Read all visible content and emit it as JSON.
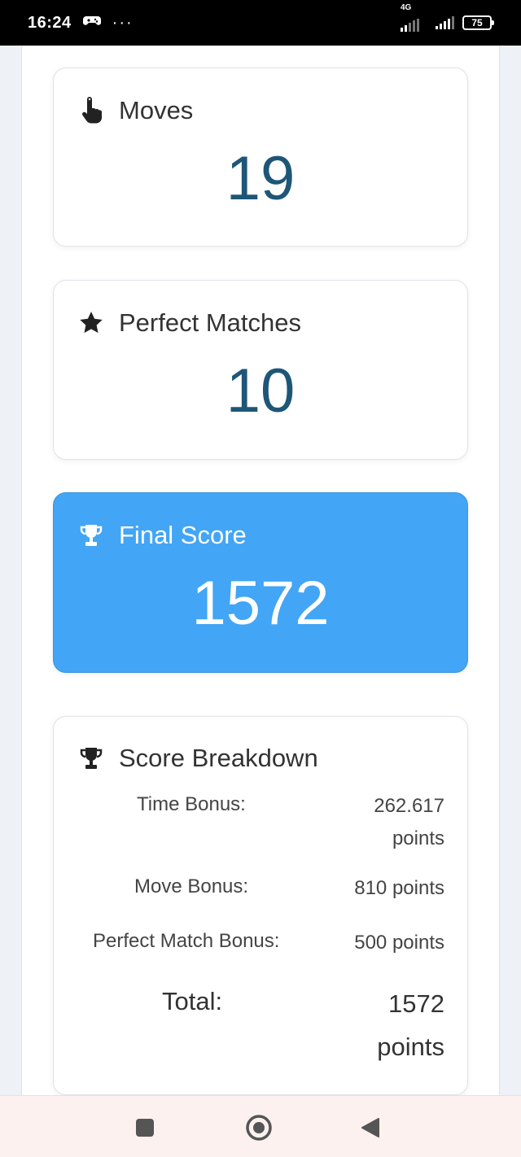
{
  "status_bar": {
    "time": "16:24",
    "more": "···",
    "network": "4G",
    "battery": "75"
  },
  "cards": {
    "moves": {
      "title": "Moves",
      "value": "19",
      "icon": "pointing-hand-icon"
    },
    "perfect": {
      "title": "Perfect Matches",
      "value": "10",
      "icon": "star-icon"
    },
    "final": {
      "title": "Final Score",
      "value": "1572",
      "icon": "trophy-icon"
    }
  },
  "breakdown": {
    "title": "Score Breakdown",
    "icon": "trophy-icon",
    "rows": [
      {
        "label": "Time Bonus:",
        "value_line1": "262.617",
        "value_line2": "points"
      },
      {
        "label": "Move Bonus:",
        "value": "810 points"
      },
      {
        "label": "Perfect Match Bonus:",
        "value": "500 points"
      }
    ],
    "total": {
      "label": "Total:",
      "value_line1": "1572",
      "value_line2": "points"
    }
  },
  "colors": {
    "accent": "#42a5f5",
    "value_text": "#1e5677"
  },
  "nav": {
    "icons": [
      "square-icon",
      "home-circle-icon",
      "back-triangle-icon"
    ]
  }
}
